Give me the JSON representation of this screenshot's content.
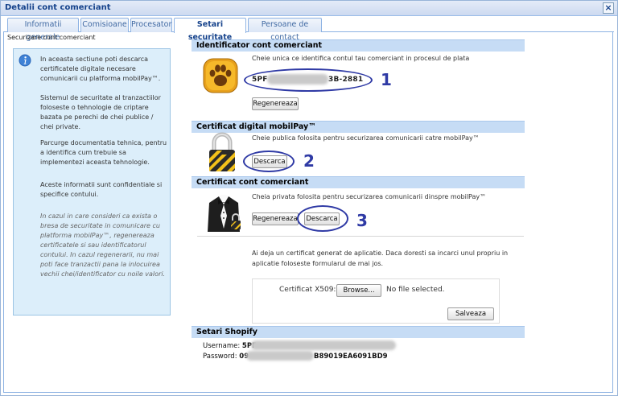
{
  "window": {
    "title": "Detalii cont comerciant"
  },
  "tabs": [
    {
      "label": "Informatii generale",
      "active": false
    },
    {
      "label": "Comisioane",
      "active": false
    },
    {
      "label": "Procesator",
      "active": false
    },
    {
      "label": "Setari securitate",
      "active": true
    },
    {
      "label": "Persoane de contact",
      "active": false
    }
  ],
  "section_label": "Securizare cont comerciant",
  "info": {
    "p1": "In aceasta sectiune poti descarca certificatele digitale necesare comunicarii cu platforma mobilPay™.",
    "p2": "Sistemul de securitate al tranzactiilor foloseste o tehnologie de criptare bazata pe perechi de chei publice / chei private.",
    "p3": "Parcurge documentatia tehnica, pentru a identifica cum trebuie sa implementezi aceasta tehnologie.",
    "p4": "Aceste informatii sunt confidentiale si specifice contului.",
    "p5": "In cazul in care consideri ca exista o bresa de securitate in comunicare cu platforma mobilPay™, regenereaza certificatele si sau identificatorul contului. In cazul regenerarii, nu mai poti face tranzactii pana la inlocuirea vechii chei/identificator cu noile valori."
  },
  "identifier": {
    "header": "Identificator cont comerciant",
    "description": "Cheie unica ce identifica contul tau comerciant in procesul de plata",
    "key_prefix": "5PF",
    "key_suffix": "3B-2881",
    "regenerate": "Regenereaza",
    "annotation": "1"
  },
  "public_cert": {
    "header": "Certificat digital mobilPay™",
    "description": "Cheie publica folosita pentru securizarea comunicarii catre mobilPay™",
    "download": "Descarca",
    "annotation": "2"
  },
  "merchant_cert": {
    "header": "Certificat cont comerciant",
    "description": "Cheia privata folosita pentru securizarea comunicarii dinspre mobilPay™",
    "regenerate": "Regenereaza",
    "download": "Descarca",
    "annotation": "3",
    "note_line1": "Ai deja un certificat generat de aplicatie. Daca doresti sa incarci unul propriu in",
    "note_line2": "aplicatie foloseste formularul de mai jos.",
    "upload_label": "Certificat X509:",
    "browse": "Browse...",
    "file_status": "No file selected.",
    "save": "Salveaza"
  },
  "shopify": {
    "header": "Setari Shopify",
    "username_label": "Username:",
    "username_prefix": "5PF",
    "password_label": "Password:",
    "password_prefix": "09",
    "password_suffix": "B89019EA6091BD9"
  },
  "colors": {
    "annotation": "#2f3aa5",
    "header_bg": "#c6dcf5",
    "info_bg": "#dceefa"
  }
}
